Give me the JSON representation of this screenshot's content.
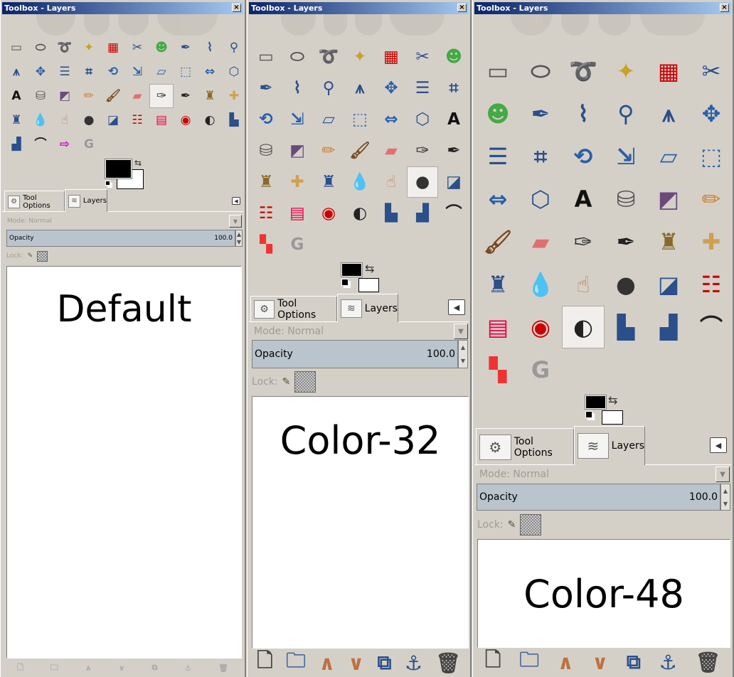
{
  "window_title": "Toolbox - Layers",
  "close_glyph": "×",
  "tabs": {
    "tool_options": "Tool Options",
    "layers": "Layers"
  },
  "mode": "Mode: Normal",
  "opacity": {
    "label": "Opacity",
    "value": "100.0"
  },
  "lock_label": "Lock:",
  "panels": [
    {
      "theme": "Default",
      "selected_tool": 26,
      "tools": [
        "rect-select",
        "ellipse-select",
        "free-select",
        "fuzzy-select",
        "select-by-color",
        "scissors",
        "foreground-select",
        "paths",
        "color-picker",
        "zoom",
        "measure",
        "move",
        "align",
        "crop",
        "rotate",
        "scale",
        "shear",
        "perspective",
        "flip",
        "cage-transform",
        "text",
        "bucket-fill",
        "blend",
        "pencil",
        "paintbrush",
        "eraser",
        "airbrush",
        "ink",
        "clone",
        "heal",
        "perspective-clone",
        "blur",
        "smudge",
        "dodge-burn",
        "desaturate",
        "color-balance",
        "hue-saturation",
        "colorize",
        "brightness-contrast",
        "threshold",
        "levels",
        "curves",
        "color-to-alpha",
        "gegl"
      ]
    },
    {
      "theme": "Color-32",
      "selected_tool": 33,
      "tools": [
        "rect-select",
        "ellipse-select",
        "free-select",
        "fuzzy-select",
        "select-by-color",
        "scissors",
        "foreground-select",
        "paths",
        "color-picker",
        "zoom",
        "measure",
        "move",
        "align",
        "crop",
        "rotate",
        "scale",
        "shear",
        "perspective",
        "flip",
        "cage-transform",
        "text",
        "bucket-fill",
        "blend",
        "pencil",
        "paintbrush",
        "eraser",
        "airbrush",
        "ink",
        "clone",
        "heal",
        "perspective-clone",
        "blur",
        "smudge",
        "dodge-burn",
        "desaturate",
        "color-balance",
        "hue-saturation",
        "colorize",
        "brightness-contrast",
        "threshold",
        "levels",
        "curves",
        "posterize",
        "gegl"
      ]
    },
    {
      "theme": "Color-48",
      "selected_tool": 38,
      "tools": [
        "rect-select",
        "ellipse-select",
        "free-select",
        "fuzzy-select",
        "select-by-color",
        "scissors",
        "foreground-select",
        "paths",
        "color-picker",
        "zoom",
        "measure",
        "move",
        "align",
        "crop",
        "rotate",
        "scale",
        "shear",
        "perspective",
        "flip",
        "cage-transform",
        "text",
        "bucket-fill",
        "blend",
        "pencil",
        "paintbrush",
        "eraser",
        "airbrush",
        "ink",
        "clone",
        "heal",
        "perspective-clone",
        "blur",
        "smudge",
        "dodge-burn",
        "desaturate",
        "color-balance",
        "hue-saturation",
        "colorize",
        "brightness-contrast",
        "threshold",
        "levels",
        "curves",
        "posterize",
        "gegl"
      ]
    }
  ],
  "layer_buttons": [
    "new-layer",
    "new-layer-group",
    "raise-layer",
    "lower-layer",
    "duplicate-layer",
    "anchor-layer",
    "delete-layer"
  ]
}
